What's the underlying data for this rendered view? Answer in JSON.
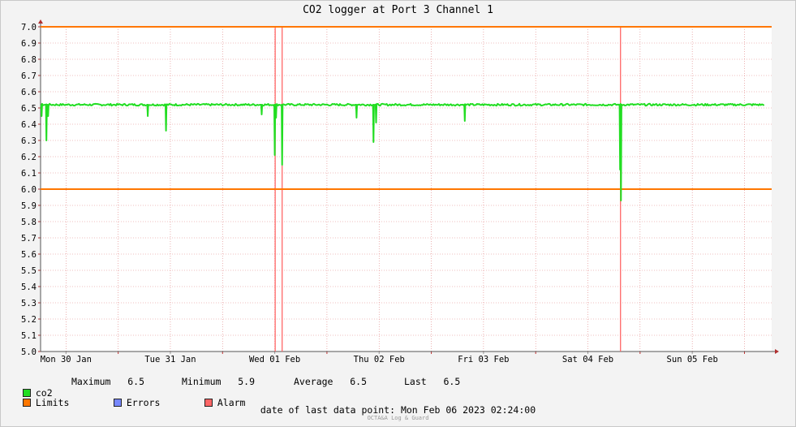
{
  "chart_data": {
    "type": "line",
    "title": "CO2 logger at Port 3 Channel 1",
    "ylim": [
      5.0,
      7.0
    ],
    "y_ticks": [
      "5.0",
      "5.1",
      "5.2",
      "5.3",
      "5.4",
      "5.5",
      "5.6",
      "5.7",
      "5.8",
      "5.9",
      "6.0",
      "6.1",
      "6.2",
      "6.3",
      "6.4",
      "6.5",
      "6.6",
      "6.7",
      "6.8",
      "6.9",
      "7.0"
    ],
    "xlim_hours": [
      0,
      172.6
    ],
    "x_tick_labels": [
      "Mon 30 Jan",
      "Tue 31 Jan",
      "Wed 01 Feb",
      "Thu 02 Feb",
      "Fri 03 Feb",
      "Sat 04 Feb",
      "Sun 05 Feb"
    ],
    "limits": [
      6.0,
      7.0
    ],
    "alarm_events_hours": [
      60.1,
      61.7,
      139.5
    ],
    "grid": true,
    "series": [
      {
        "name": "co2",
        "color": "#22dd22",
        "baseline": 6.52,
        "dips": [
          {
            "t": 6.4,
            "min": 6.45
          },
          {
            "t": 7.5,
            "min": 6.3
          },
          {
            "t": 7.9,
            "min": 6.45
          },
          {
            "t": 30.8,
            "min": 6.45
          },
          {
            "t": 35.0,
            "min": 6.36
          },
          {
            "t": 57.0,
            "min": 6.46
          },
          {
            "t": 60.0,
            "min": 6.21
          },
          {
            "t": 60.3,
            "min": 6.44
          },
          {
            "t": 61.7,
            "min": 6.15
          },
          {
            "t": 78.8,
            "min": 6.44
          },
          {
            "t": 82.7,
            "min": 6.29
          },
          {
            "t": 83.3,
            "min": 6.41
          },
          {
            "t": 103.7,
            "min": 6.42
          },
          {
            "t": 139.4,
            "min": 6.12
          },
          {
            "t": 139.6,
            "min": 5.93
          }
        ]
      }
    ]
  },
  "legend": {
    "co2_name": "co2",
    "max_label": "Maximum",
    "max_value": "6.5",
    "min_label": "Minimum",
    "min_value": "5.9",
    "avg_label": "Average",
    "avg_value": "6.5",
    "last_label": "Last",
    "last_value": "6.5",
    "limits_label": "Limits",
    "errors_label": "Errors",
    "alarm_label": "Alarm"
  },
  "colors": {
    "co2": "#22dd22",
    "limits": "#ff7700",
    "errors": "#7788ff",
    "alarm": "#ff6666",
    "grid": "#e08080",
    "plot_bg": "#ffffff",
    "page_bg": "#f3f3f3"
  },
  "footer": {
    "text": "date of last data point:  Mon Feb 06 2023 02:24:00",
    "credit": "OCTA&A Log & Guard"
  }
}
